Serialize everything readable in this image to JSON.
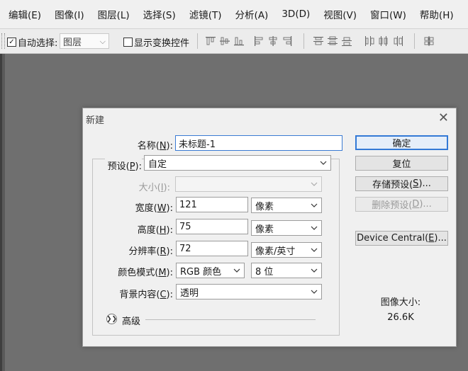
{
  "menu": {
    "items": [
      "编辑(E)",
      "图像(I)",
      "图层(L)",
      "选择(S)",
      "滤镜(T)",
      "分析(A)",
      "3D(D)",
      "视图(V)",
      "窗口(W)",
      "帮助(H)"
    ]
  },
  "options_bar": {
    "auto_select_label": "自动选择:",
    "auto_select_checked": true,
    "auto_select_target": "图层",
    "show_transform_label": "显示变换控件",
    "show_transform_checked": false
  },
  "dialog": {
    "title": "新建",
    "name_label": "名称(N):",
    "name_value": "未标题-1",
    "preset_label": "预设(P):",
    "preset_value": "自定",
    "size_label": "大小(I):",
    "size_value": "",
    "width_label": "宽度(W):",
    "width_value": "121",
    "width_unit": "像素",
    "height_label": "高度(H):",
    "height_value": "75",
    "height_unit": "像素",
    "resolution_label": "分辨率(R):",
    "resolution_value": "72",
    "resolution_unit": "像素/英寸",
    "color_mode_label": "颜色模式(M):",
    "color_mode_value": "RGB 颜色",
    "bit_depth_value": "8 位",
    "background_label": "背景内容(C):",
    "background_value": "透明",
    "advanced_label": "高级",
    "buttons": {
      "ok": "确定",
      "reset": "复位",
      "save_preset": "存储预设(S)...",
      "delete_preset": "删除预设(D)...",
      "device_central": "Device Central(E)..."
    },
    "image_size_label": "图像大小:",
    "image_size_value": "26.6K"
  },
  "colors": {
    "canvas_bg": "#6f6f6f",
    "accent": "#3379d6"
  }
}
